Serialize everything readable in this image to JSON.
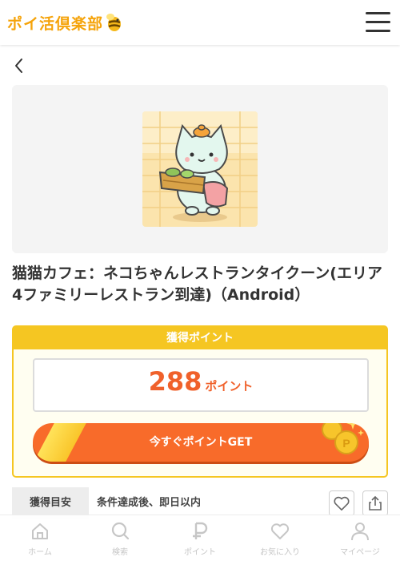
{
  "header": {
    "logo_text": "ポイ活倶楽部",
    "menu_icon": "hamburger-menu-icon"
  },
  "back_icon": "chevron-left-icon",
  "offer": {
    "title": "猫猫カフェ：ネコちゃんレストランタイクーン(エリア4ファミリーレストラン到達)（Android）",
    "image_description": "cat-character-holding-tray"
  },
  "points": {
    "header": "獲得ポイント",
    "value": "288",
    "unit": "ポイント",
    "cta_label": "今すぐポイントGET"
  },
  "info": {
    "label": "獲得目安",
    "value": "条件達成後、即日以内"
  },
  "bottom_nav": [
    {
      "label": "ホーム",
      "icon": "home-icon"
    },
    {
      "label": "検索",
      "icon": "search-icon"
    },
    {
      "label": "ポイント",
      "icon": "point-icon"
    },
    {
      "label": "お気に入り",
      "icon": "heart-icon"
    },
    {
      "label": "マイページ",
      "icon": "user-icon"
    }
  ],
  "colors": {
    "brand_yellow": "#f5c622",
    "accent_orange": "#f0612b",
    "button_orange": "#f86b2a"
  }
}
